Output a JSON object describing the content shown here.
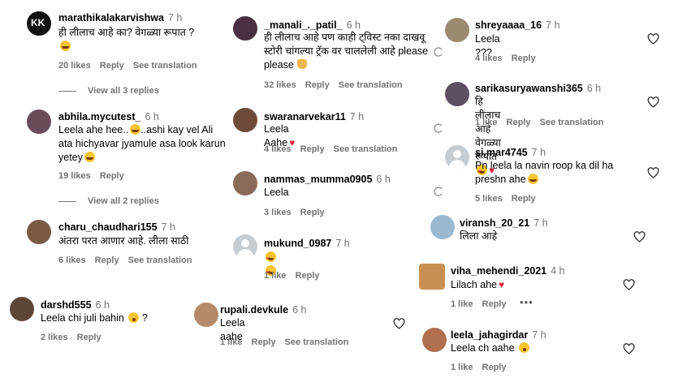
{
  "col1": [
    {
      "username": "marathikalakarvishwa",
      "time": "7 h",
      "text": "ही लीलाच आहे का? वेगळ्या रूपात ?",
      "emoji": "tear",
      "likes": "20 likes",
      "reply": "Reply",
      "translate": "See translation",
      "view": "View all 3 replies",
      "avatar_letters": "KK",
      "avatar_color": "#111111"
    },
    {
      "username": "abhila.mycutest_",
      "time": "6 h",
      "text": "Leela ahe hee..",
      "text2": "..ashi kay vel Ali ata hichyavar jyamule asa look karun yetey",
      "likes": "19 likes",
      "reply": "Reply",
      "view": "View all 2 replies",
      "avatar_color": "#6b4b5a"
    },
    {
      "username": "charu_chaudhari155",
      "time": "7 h",
      "text": "अंतरा परत आणार आहे. लीला साठी",
      "likes": "6 likes",
      "reply": "Reply",
      "translate": "See translation",
      "avatar_color": "#7a5a45"
    },
    {
      "username": "darshd555",
      "time": "6 h",
      "text": "Leela chi juli bahin",
      "likes": "2 likes",
      "reply": "Reply",
      "avatar_color": "#5d4638"
    }
  ],
  "col2": [
    {
      "username": "_manali_._patil_",
      "time": "6 h",
      "text": "ही लीलाच आहे पण काही ट्विस्ट नका दाखवू स्टोरी चांगल्या ट्रॅक वर चाललेली आहे please please",
      "likes": "32 likes",
      "reply": "Reply",
      "translate": "See translation",
      "avatar_color": "#4a3040"
    },
    {
      "username": "swaranarvekar11",
      "time": "7 h",
      "text": "Leela Aahe",
      "likes": "4 likes",
      "reply": "Reply",
      "translate": "See translation",
      "avatar_color": "#6e4a3a"
    },
    {
      "username": "nammas_mumma0905",
      "time": "6 h",
      "text": "Leela",
      "likes": "3 likes",
      "reply": "Reply",
      "avatar_color": "#8a6a58"
    },
    {
      "username": "mukund_0987",
      "time": "7 h",
      "likes": "1 like",
      "reply": "Reply",
      "avatar_color": "#c7ccd1"
    },
    {
      "username": "rupali.devkule",
      "time": "6 h",
      "text": "Leela aahe",
      "likes": "1 like",
      "reply": "Reply",
      "translate": "See translation",
      "avatar_color": "#b48a6a"
    }
  ],
  "col3": [
    {
      "username": "shreyaaaa_16",
      "time": "7 h",
      "text": "Leela ???",
      "likes": "4 likes",
      "reply": "Reply",
      "avatar_color": "#9a8a70"
    },
    {
      "username": "sarikasuryawanshi365",
      "time": "6 h",
      "text": "हि लीलाच आहे वेगळ्या रूपात",
      "likes": "1 like",
      "reply": "Reply",
      "translate": "See translation",
      "avatar_color": "#5a5060"
    },
    {
      "username": "si.mar4745",
      "time": "7 h",
      "text": "Pn leela la navin roop ka dil ha preshn ahe",
      "likes": "5 likes",
      "reply": "Reply",
      "avatar_color": "#c7ccd1"
    },
    {
      "username": "viransh_20_21",
      "time": "7 h",
      "text": "लिला आहे",
      "avatar_color": "#9ab8d0"
    },
    {
      "username": "viha_mehendi_2021",
      "time": "4 h",
      "text": "Lilach ahe",
      "likes": "1 like",
      "reply": "Reply",
      "avatar_color": "#c89050"
    },
    {
      "username": "leela_jahagirdar",
      "time": "7 h",
      "text": "Leela ch aahe",
      "likes": "1 like",
      "reply": "Reply",
      "avatar_color": "#b07050"
    }
  ]
}
